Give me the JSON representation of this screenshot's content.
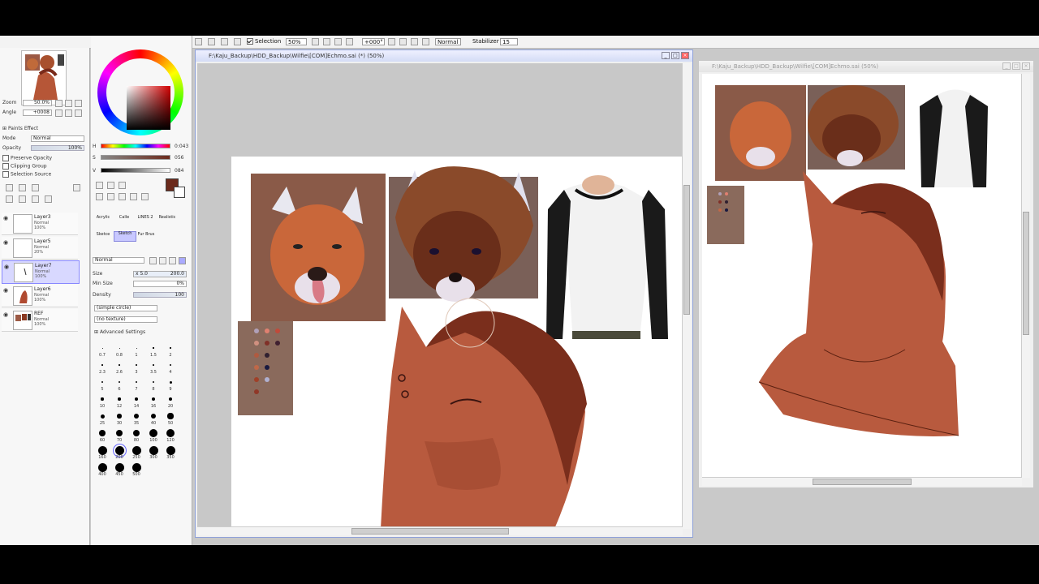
{
  "toolbar": {
    "selection_label": "Selection",
    "zoom": "50%",
    "angle": "+000°",
    "blend_mode": "Normal",
    "stabilizer_label": "Stabilizer",
    "stabilizer_value": "15"
  },
  "navigator": {
    "zoom_label": "Zoom",
    "zoom_value": "50.0%",
    "angle_label": "Angle",
    "angle_value": "+0008"
  },
  "layer_panel": {
    "paint_effects": "Paints Effect",
    "mode_label": "Mode",
    "mode_value": "Normal",
    "opacity_label": "Opacity",
    "opacity_value": "100%",
    "preserve_opacity": "Preserve Opacity",
    "clipping_group": "Clipping Group",
    "selection_source": "Selection Source",
    "layers": [
      {
        "name": "Layer3",
        "mode": "Normal",
        "opacity": "100%"
      },
      {
        "name": "Layer5",
        "mode": "Normal",
        "opacity": "20%"
      },
      {
        "name": "Layer7",
        "mode": "Normal",
        "opacity": "100%"
      },
      {
        "name": "Layer6",
        "mode": "Normal",
        "opacity": "100%"
      },
      {
        "name": "REF",
        "mode": "Normal",
        "opacity": "100%"
      }
    ]
  },
  "color": {
    "h_label": "H",
    "h_value": "0:043",
    "s_label": "S",
    "s_value": "056",
    "v_label": "V",
    "v_value": "084",
    "current": "#6b2a1c"
  },
  "brush_panel": {
    "tools": [
      "Acrylic",
      "Calle",
      "LINES 2",
      "Realistic",
      "Sketce",
      "Sketch",
      "Fur Brus"
    ],
    "blend": "Normal",
    "size_label": "Size",
    "size_mult": "x 5.0",
    "size_value": "200.0",
    "min_size_label": "Min Size",
    "min_size_value": "0%",
    "density_label": "Density",
    "density_value": "100",
    "shape": "(simple circle)",
    "texture": "(no texture)",
    "advanced": "Advanced Settings",
    "sizes": [
      "0.7",
      "0.8",
      "1",
      "1.5",
      "2",
      "2.3",
      "2.6",
      "3",
      "3.5",
      "4",
      "5",
      "6",
      "7",
      "8",
      "9",
      "10",
      "12",
      "14",
      "16",
      "20",
      "25",
      "30",
      "35",
      "40",
      "50",
      "60",
      "70",
      "80",
      "100",
      "120",
      "160",
      "200",
      "250",
      "300",
      "350",
      "400",
      "450",
      "500"
    ]
  },
  "main_window": {
    "title": "F:\\Kaju_Backup\\HDD_Backup\\Wilfie\\[COM]Echmo.sai (*) (50%)"
  },
  "ref_window": {
    "title": "F:\\Kaju_Backup\\HDD_Backup\\Wilfie\\[COM]Echmo.sai (50%)"
  }
}
